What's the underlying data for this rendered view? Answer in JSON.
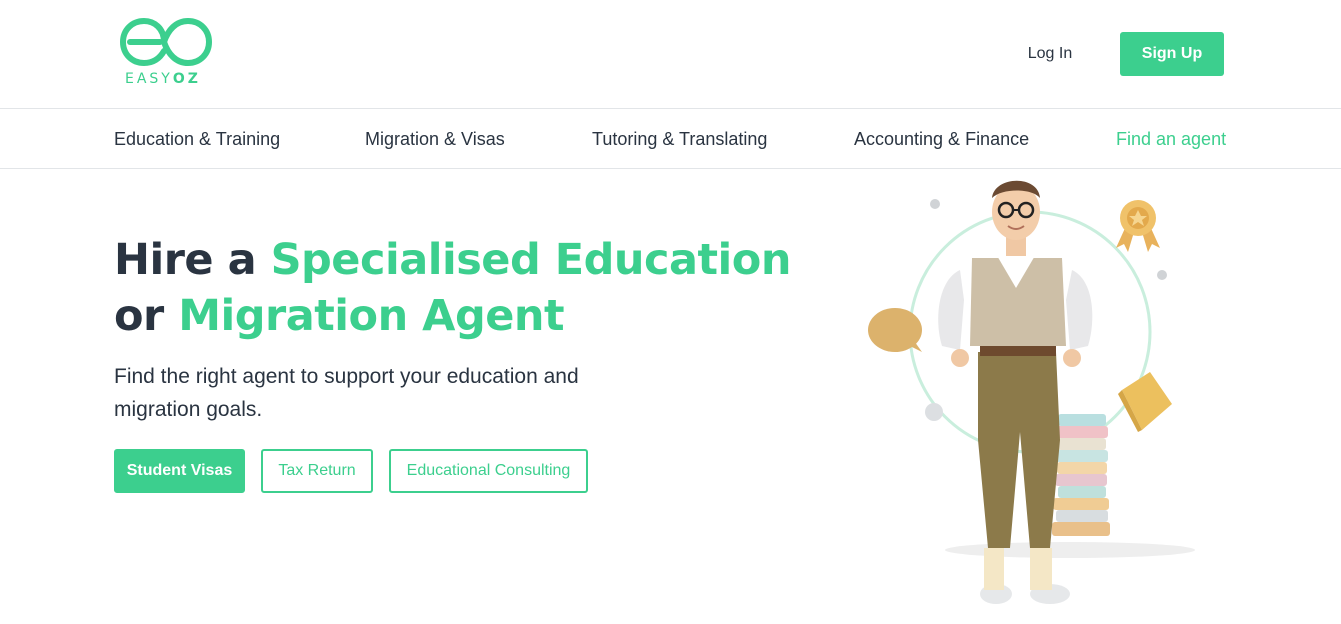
{
  "brand": {
    "name_light": "EASY",
    "name_bold": "OZ",
    "color": "#3ccf8e"
  },
  "header": {
    "login_label": "Log In",
    "signup_label": "Sign Up"
  },
  "nav": {
    "items": [
      {
        "label": "Education & Training"
      },
      {
        "label": "Migration & Visas"
      },
      {
        "label": "Tutoring & Translating"
      },
      {
        "label": "Accounting & Finance"
      },
      {
        "label": "Find an agent"
      }
    ]
  },
  "hero": {
    "title_part1": "Hire a ",
    "title_part2": "Specialised Education",
    "title_part3": "or ",
    "title_part4": "Migration Agent",
    "subtitle": "Find the right agent to support your education and migration goals.",
    "tags": [
      {
        "label": "Student Visas"
      },
      {
        "label": "Tax Return"
      },
      {
        "label": "Educational Consulting"
      }
    ]
  },
  "colors": {
    "accent": "#3ccf8e",
    "text": "#2a3441",
    "divider": "#e2e5e8"
  },
  "icons": [
    "easyoz-logo-icon",
    "speech-bubble-icon",
    "award-badge-icon",
    "book-icon"
  ]
}
